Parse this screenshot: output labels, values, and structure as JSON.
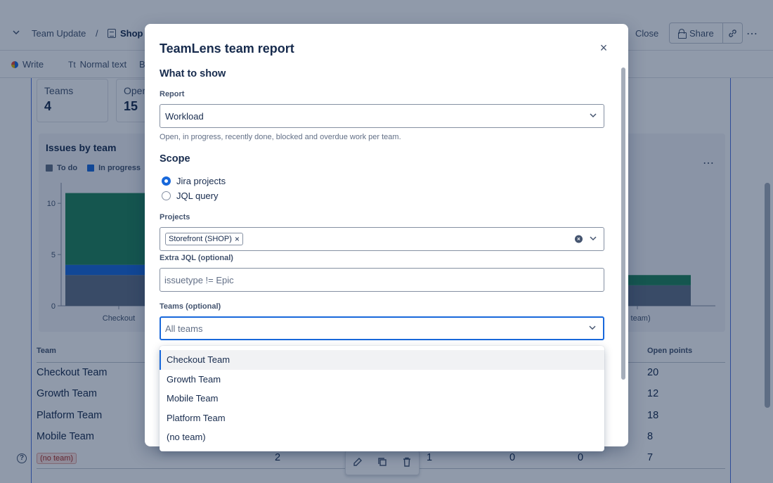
{
  "topbar": {
    "breadcrumb_parent": "Team Update",
    "breadcrumb_sep": "/",
    "breadcrumb_current": "Shop",
    "close_label": "Close",
    "share_label": "Share"
  },
  "toolbar": {
    "write_label": "Write",
    "text_style_icon": "Tt",
    "text_style_label": "Normal text",
    "next_item_partial": "B"
  },
  "stats": [
    {
      "label": "Teams",
      "value": "4"
    },
    {
      "label": "Oper",
      "value": "15"
    }
  ],
  "chart_data": {
    "type": "bar",
    "stacked": true,
    "title": "Issues by team",
    "categories": [
      "Checkout Team",
      "(no team)"
    ],
    "category_labels_visible": [
      "Checkout",
      "o team)"
    ],
    "series": [
      {
        "name": "To do",
        "color": "#626f86",
        "values": [
          3,
          2
        ]
      },
      {
        "name": "In progress",
        "color": "#1868db",
        "values": [
          1,
          0
        ]
      },
      {
        "name": "",
        "color": "#1f845a",
        "values": [
          7,
          1
        ]
      }
    ],
    "yticks": [
      0,
      5,
      10
    ],
    "ylim": [
      0,
      12
    ],
    "grid": false,
    "legend": "top-left"
  },
  "table": {
    "header_team": "Team",
    "header_points": "Open points",
    "rows": [
      {
        "team": "Checkout Team",
        "points": "20"
      },
      {
        "team": "Growth Team",
        "points": "12"
      },
      {
        "team": "Platform Team",
        "points": "18"
      },
      {
        "team": "Mobile Team",
        "points": "8"
      }
    ],
    "no_team_row": {
      "badge": "(no team)",
      "c1": "2",
      "c2": "1",
      "c3": "0",
      "c4": "0",
      "points": "7"
    }
  },
  "help_glyph": "?",
  "modal": {
    "title": "TeamLens team report",
    "close_glyph": "×",
    "what_to_show_heading": "What to show",
    "report_label": "Report",
    "report_value": "Workload",
    "report_help": "Open, in progress, recently done, blocked and overdue work per team.",
    "scope_heading": "Scope",
    "scope_options": [
      {
        "label": "Jira projects",
        "checked": true
      },
      {
        "label": "JQL query",
        "checked": false
      }
    ],
    "projects_label": "Projects",
    "project_tag": "Storefront (SHOP)",
    "tag_remove_glyph": "×",
    "extra_jql_label": "Extra JQL (optional)",
    "extra_jql_placeholder": "issuetype != Epic",
    "teams_label": "Teams (optional)",
    "teams_placeholder": "All teams",
    "team_options": [
      "Checkout Team",
      "Growth Team",
      "Mobile Team",
      "Platform Team",
      "(no team)"
    ]
  },
  "colors": {
    "accent": "#1868db",
    "overlay": "rgba(9,30,66,0.45)",
    "done": "#1f845a",
    "todo": "#626f86"
  }
}
